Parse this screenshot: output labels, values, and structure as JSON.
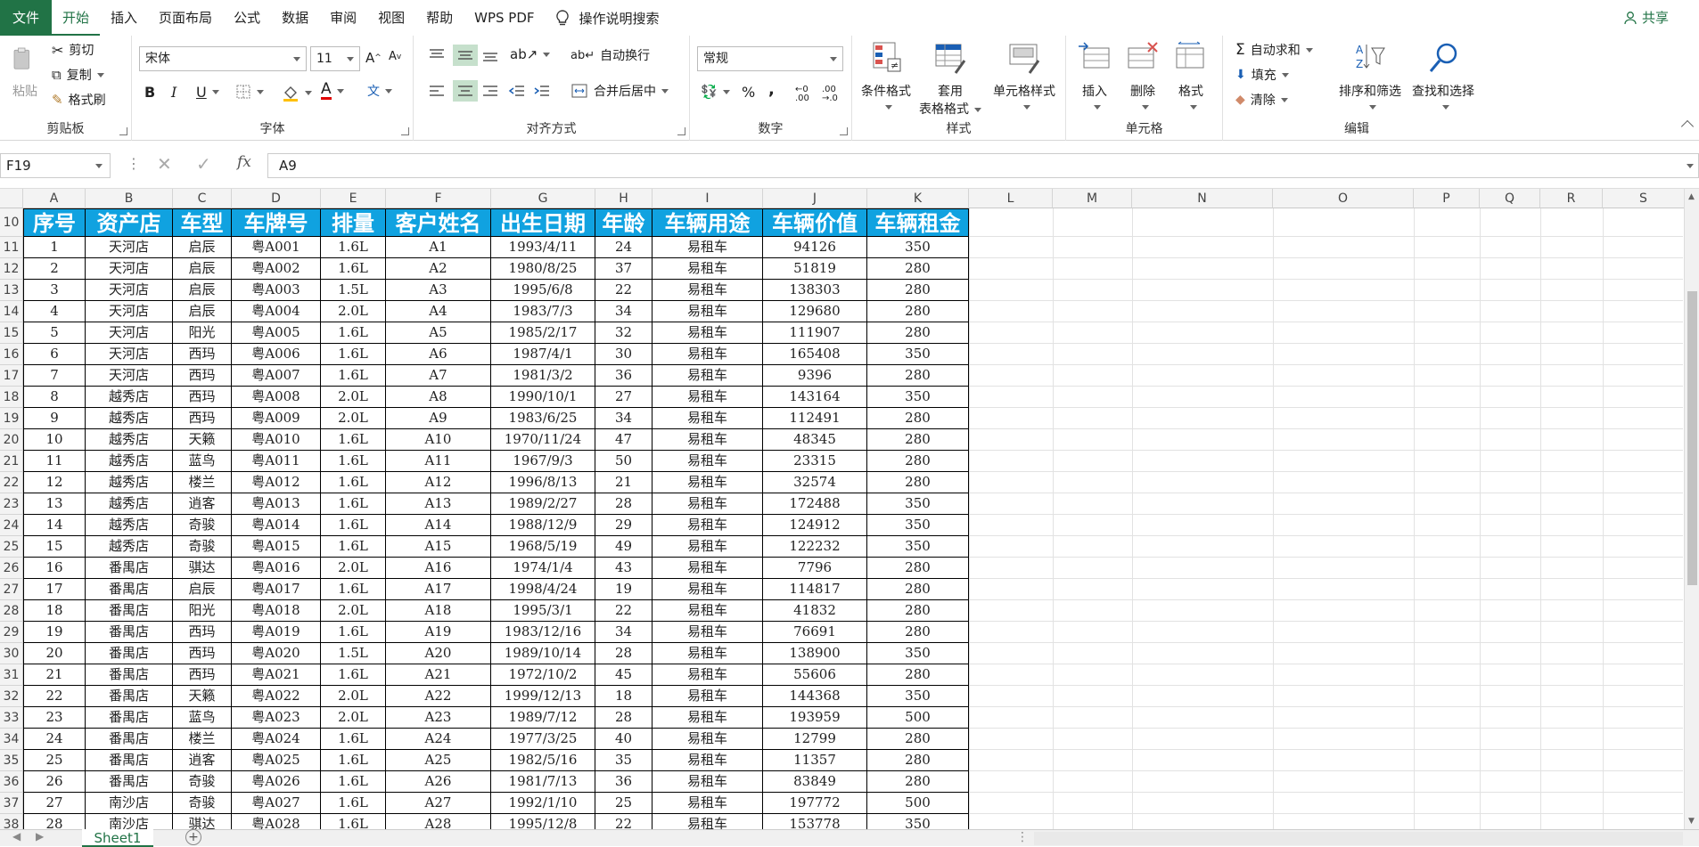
{
  "tabs": {
    "file": "文件",
    "home": "开始",
    "insert": "插入",
    "layout": "页面布局",
    "formulas": "公式",
    "data": "数据",
    "review": "审阅",
    "view": "视图",
    "help": "帮助",
    "wps": "WPS PDF",
    "search": "操作说明搜索",
    "share": "共享"
  },
  "ribbon": {
    "clipboard": {
      "label": "剪贴板",
      "paste": "粘贴",
      "cut": "剪切",
      "copy": "复制",
      "format_painter": "格式刷"
    },
    "font": {
      "label": "字体",
      "name": "宋体",
      "size": "11",
      "bold": "B",
      "italic": "I",
      "underline": "U",
      "grow": "A",
      "shrink": "A",
      "font_color_glyph": "A",
      "wen": "文"
    },
    "align": {
      "label": "对齐方式",
      "wrap": "自动换行",
      "merge": "合并后居中"
    },
    "number": {
      "label": "数字",
      "format": "常规",
      "percent": "%",
      "comma": ","
    },
    "styles": {
      "label": "样式",
      "cond": "条件格式",
      "table_1": "套用",
      "table_2": "表格格式",
      "cell_styles": "单元格样式"
    },
    "cells": {
      "label": "单元格",
      "insert": "插入",
      "delete": "删除",
      "format": "格式"
    },
    "editing": {
      "label": "编辑",
      "autosum": "自动求和",
      "fill": "填充",
      "clear": "清除",
      "sort": "排序和筛选",
      "find": "查找和选择"
    }
  },
  "formula_bar": {
    "name_box": "F19",
    "content": "A9",
    "fx": "fx"
  },
  "columns": [
    "A",
    "B",
    "C",
    "D",
    "E",
    "F",
    "G",
    "H",
    "I",
    "J",
    "K",
    "L",
    "M",
    "N",
    "O",
    "P",
    "Q",
    "R",
    "S"
  ],
  "header_row": {
    "row": "10",
    "cells": [
      "序号",
      "资产店",
      "车型",
      "车牌号",
      "排量",
      "客户姓名",
      "出生日期",
      "年龄",
      "车辆用途",
      "车辆价值",
      "车辆租金"
    ]
  },
  "rows": [
    {
      "r": "11",
      "c": [
        "1",
        "天河店",
        "启辰",
        "粤A001",
        "1.6L",
        "A1",
        "1993/4/11",
        "24",
        "易租车",
        "94126",
        "350"
      ]
    },
    {
      "r": "12",
      "c": [
        "2",
        "天河店",
        "启辰",
        "粤A002",
        "1.6L",
        "A2",
        "1980/8/25",
        "37",
        "易租车",
        "51819",
        "280"
      ]
    },
    {
      "r": "13",
      "c": [
        "3",
        "天河店",
        "启辰",
        "粤A003",
        "1.5L",
        "A3",
        "1995/6/8",
        "22",
        "易租车",
        "138303",
        "280"
      ]
    },
    {
      "r": "14",
      "c": [
        "4",
        "天河店",
        "启辰",
        "粤A004",
        "2.0L",
        "A4",
        "1983/7/3",
        "34",
        "易租车",
        "129680",
        "280"
      ]
    },
    {
      "r": "15",
      "c": [
        "5",
        "天河店",
        "阳光",
        "粤A005",
        "1.6L",
        "A5",
        "1985/2/17",
        "32",
        "易租车",
        "111907",
        "280"
      ]
    },
    {
      "r": "16",
      "c": [
        "6",
        "天河店",
        "西玛",
        "粤A006",
        "1.6L",
        "A6",
        "1987/4/1",
        "30",
        "易租车",
        "165408",
        "350"
      ]
    },
    {
      "r": "17",
      "c": [
        "7",
        "天河店",
        "西玛",
        "粤A007",
        "1.6L",
        "A7",
        "1981/3/2",
        "36",
        "易租车",
        "9396",
        "280"
      ]
    },
    {
      "r": "18",
      "c": [
        "8",
        "越秀店",
        "西玛",
        "粤A008",
        "2.0L",
        "A8",
        "1990/10/1",
        "27",
        "易租车",
        "143164",
        "350"
      ]
    },
    {
      "r": "19",
      "c": [
        "9",
        "越秀店",
        "西玛",
        "粤A009",
        "2.0L",
        "A9",
        "1983/6/25",
        "34",
        "易租车",
        "112491",
        "280"
      ]
    },
    {
      "r": "20",
      "c": [
        "10",
        "越秀店",
        "天籁",
        "粤A010",
        "1.6L",
        "A10",
        "1970/11/24",
        "47",
        "易租车",
        "48345",
        "280"
      ]
    },
    {
      "r": "21",
      "c": [
        "11",
        "越秀店",
        "蓝鸟",
        "粤A011",
        "1.6L",
        "A11",
        "1967/9/3",
        "50",
        "易租车",
        "23315",
        "280"
      ]
    },
    {
      "r": "22",
      "c": [
        "12",
        "越秀店",
        "楼兰",
        "粤A012",
        "1.6L",
        "A12",
        "1996/8/13",
        "21",
        "易租车",
        "32574",
        "280"
      ]
    },
    {
      "r": "23",
      "c": [
        "13",
        "越秀店",
        "逍客",
        "粤A013",
        "1.6L",
        "A13",
        "1989/2/27",
        "28",
        "易租车",
        "172488",
        "350"
      ]
    },
    {
      "r": "24",
      "c": [
        "14",
        "越秀店",
        "奇骏",
        "粤A014",
        "1.6L",
        "A14",
        "1988/12/9",
        "29",
        "易租车",
        "124912",
        "350"
      ]
    },
    {
      "r": "25",
      "c": [
        "15",
        "越秀店",
        "奇骏",
        "粤A015",
        "1.6L",
        "A15",
        "1968/5/19",
        "49",
        "易租车",
        "122232",
        "350"
      ]
    },
    {
      "r": "26",
      "c": [
        "16",
        "番禺店",
        "骐达",
        "粤A016",
        "2.0L",
        "A16",
        "1974/1/4",
        "43",
        "易租车",
        "7796",
        "280"
      ]
    },
    {
      "r": "27",
      "c": [
        "17",
        "番禺店",
        "启辰",
        "粤A017",
        "1.6L",
        "A17",
        "1998/4/24",
        "19",
        "易租车",
        "114817",
        "280"
      ]
    },
    {
      "r": "28",
      "c": [
        "18",
        "番禺店",
        "阳光",
        "粤A018",
        "2.0L",
        "A18",
        "1995/3/1",
        "22",
        "易租车",
        "41832",
        "280"
      ]
    },
    {
      "r": "29",
      "c": [
        "19",
        "番禺店",
        "西玛",
        "粤A019",
        "1.6L",
        "A19",
        "1983/12/16",
        "34",
        "易租车",
        "76691",
        "280"
      ]
    },
    {
      "r": "30",
      "c": [
        "20",
        "番禺店",
        "西玛",
        "粤A020",
        "1.5L",
        "A20",
        "1989/10/14",
        "28",
        "易租车",
        "138900",
        "350"
      ]
    },
    {
      "r": "31",
      "c": [
        "21",
        "番禺店",
        "西玛",
        "粤A021",
        "1.6L",
        "A21",
        "1972/10/2",
        "45",
        "易租车",
        "55606",
        "280"
      ]
    },
    {
      "r": "32",
      "c": [
        "22",
        "番禺店",
        "天籁",
        "粤A022",
        "2.0L",
        "A22",
        "1999/12/13",
        "18",
        "易租车",
        "144368",
        "350"
      ]
    },
    {
      "r": "33",
      "c": [
        "23",
        "番禺店",
        "蓝鸟",
        "粤A023",
        "2.0L",
        "A23",
        "1989/7/12",
        "28",
        "易租车",
        "193959",
        "500"
      ]
    },
    {
      "r": "34",
      "c": [
        "24",
        "番禺店",
        "楼兰",
        "粤A024",
        "1.6L",
        "A24",
        "1977/3/25",
        "40",
        "易租车",
        "12799",
        "280"
      ]
    },
    {
      "r": "35",
      "c": [
        "25",
        "番禺店",
        "逍客",
        "粤A025",
        "1.6L",
        "A25",
        "1982/5/16",
        "35",
        "易租车",
        "11357",
        "280"
      ]
    },
    {
      "r": "36",
      "c": [
        "26",
        "番禺店",
        "奇骏",
        "粤A026",
        "1.6L",
        "A26",
        "1981/7/13",
        "36",
        "易租车",
        "83849",
        "280"
      ]
    },
    {
      "r": "37",
      "c": [
        "27",
        "南沙店",
        "奇骏",
        "粤A027",
        "1.6L",
        "A27",
        "1992/1/10",
        "25",
        "易租车",
        "197772",
        "500"
      ]
    },
    {
      "r": "38",
      "c": [
        "28",
        "南沙店",
        "骐达",
        "粤A028",
        "1.6L",
        "A28",
        "1995/12/8",
        "22",
        "易租车",
        "153778",
        "350"
      ]
    }
  ],
  "sheet": {
    "name": "Sheet1",
    "add": "+"
  },
  "colors": {
    "accent": "#217346",
    "header_fill": "#10a2e0"
  }
}
